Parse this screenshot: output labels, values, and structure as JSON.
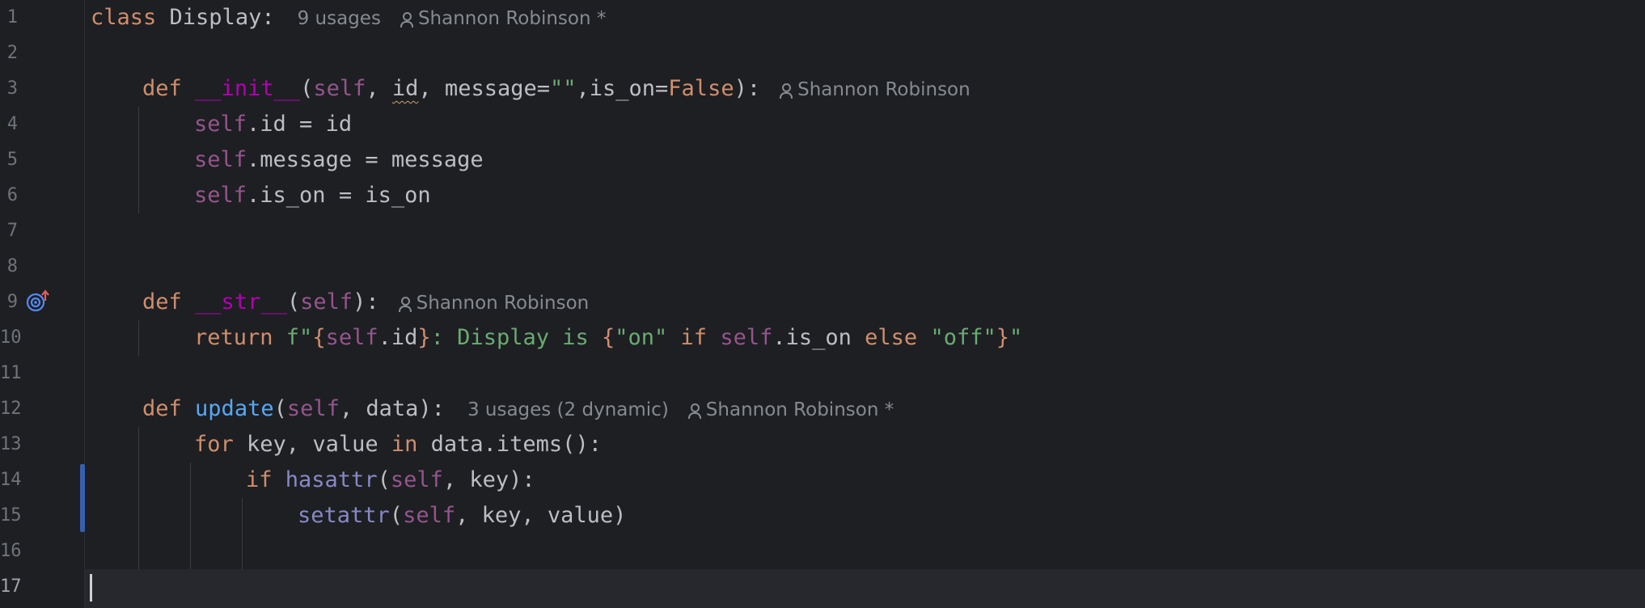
{
  "editor": {
    "lines": [
      {
        "num": "1"
      },
      {
        "num": "2"
      },
      {
        "num": "3"
      },
      {
        "num": "4"
      },
      {
        "num": "5"
      },
      {
        "num": "6"
      },
      {
        "num": "7"
      },
      {
        "num": "8"
      },
      {
        "num": "9"
      },
      {
        "num": "10"
      },
      {
        "num": "11"
      },
      {
        "num": "12"
      },
      {
        "num": "13"
      },
      {
        "num": "14"
      },
      {
        "num": "15"
      },
      {
        "num": "16"
      },
      {
        "num": "17"
      }
    ],
    "hints": {
      "class_usages": "9 usages",
      "class_author": "Shannon Robinson *",
      "init_author": "Shannon Robinson",
      "str_author": "Shannon Robinson",
      "update_usages": "3 usages (2 dynamic)",
      "update_author": "Shannon Robinson *"
    },
    "code": {
      "l1_kw": "class",
      "l1_name": " Display:",
      "l3_kw": "def",
      "l3_fn": "__init__",
      "l3_open": "(",
      "l3_self": "self",
      "l3_sep1": ", ",
      "l3_id": "id",
      "l3_rest1": ", message=",
      "l3_str": "\"\"",
      "l3_rest2": ",is_on=",
      "l3_false": "False",
      "l3_close": "):",
      "l4_self": "self",
      "l4_rest": ".id = id",
      "l5_self": "self",
      "l5_rest": ".message = message",
      "l6_self": "self",
      "l6_rest": ".is_on = is_on",
      "l9_kw": "def",
      "l9_fn": "__str__",
      "l9_open": "(",
      "l9_self": "self",
      "l9_close": "):",
      "l10_kw": "return",
      "l10_f": " f\"",
      "l10_b1": "{",
      "l10_self1": "self",
      "l10_id": ".id",
      "l10_b2": "}",
      "l10_mid": ": Display is ",
      "l10_b3": "{",
      "l10_on": "\"on\"",
      "l10_if": " if ",
      "l10_self2": "self",
      "l10_ison": ".is_on",
      "l10_else": " else ",
      "l10_off": "\"off\"",
      "l10_b4": "}",
      "l10_end": "\"",
      "l12_kw": "def",
      "l12_fn": "update",
      "l12_open": "(",
      "l12_self": "self",
      "l12_rest": ", data):",
      "l13_for": "for",
      "l13_mid": " key, value ",
      "l13_in": "in",
      "l13_rest": " data.items():",
      "l14_if": "if",
      "l14_fn": "hasattr",
      "l14_open": "(",
      "l14_self": "self",
      "l14_rest": ", key):",
      "l15_fn": "setattr",
      "l15_open": "(",
      "l15_self": "self",
      "l15_rest": ", key, value)"
    },
    "icons": {
      "override": "override-method-icon",
      "author": "person-icon"
    },
    "colors": {
      "keyword": "#cf8e6d",
      "self": "#94558d",
      "dunder": "#b200b2",
      "function": "#56a8f5",
      "string": "#6aab73",
      "builtin": "#8888c6",
      "background": "#1e1f22"
    }
  }
}
